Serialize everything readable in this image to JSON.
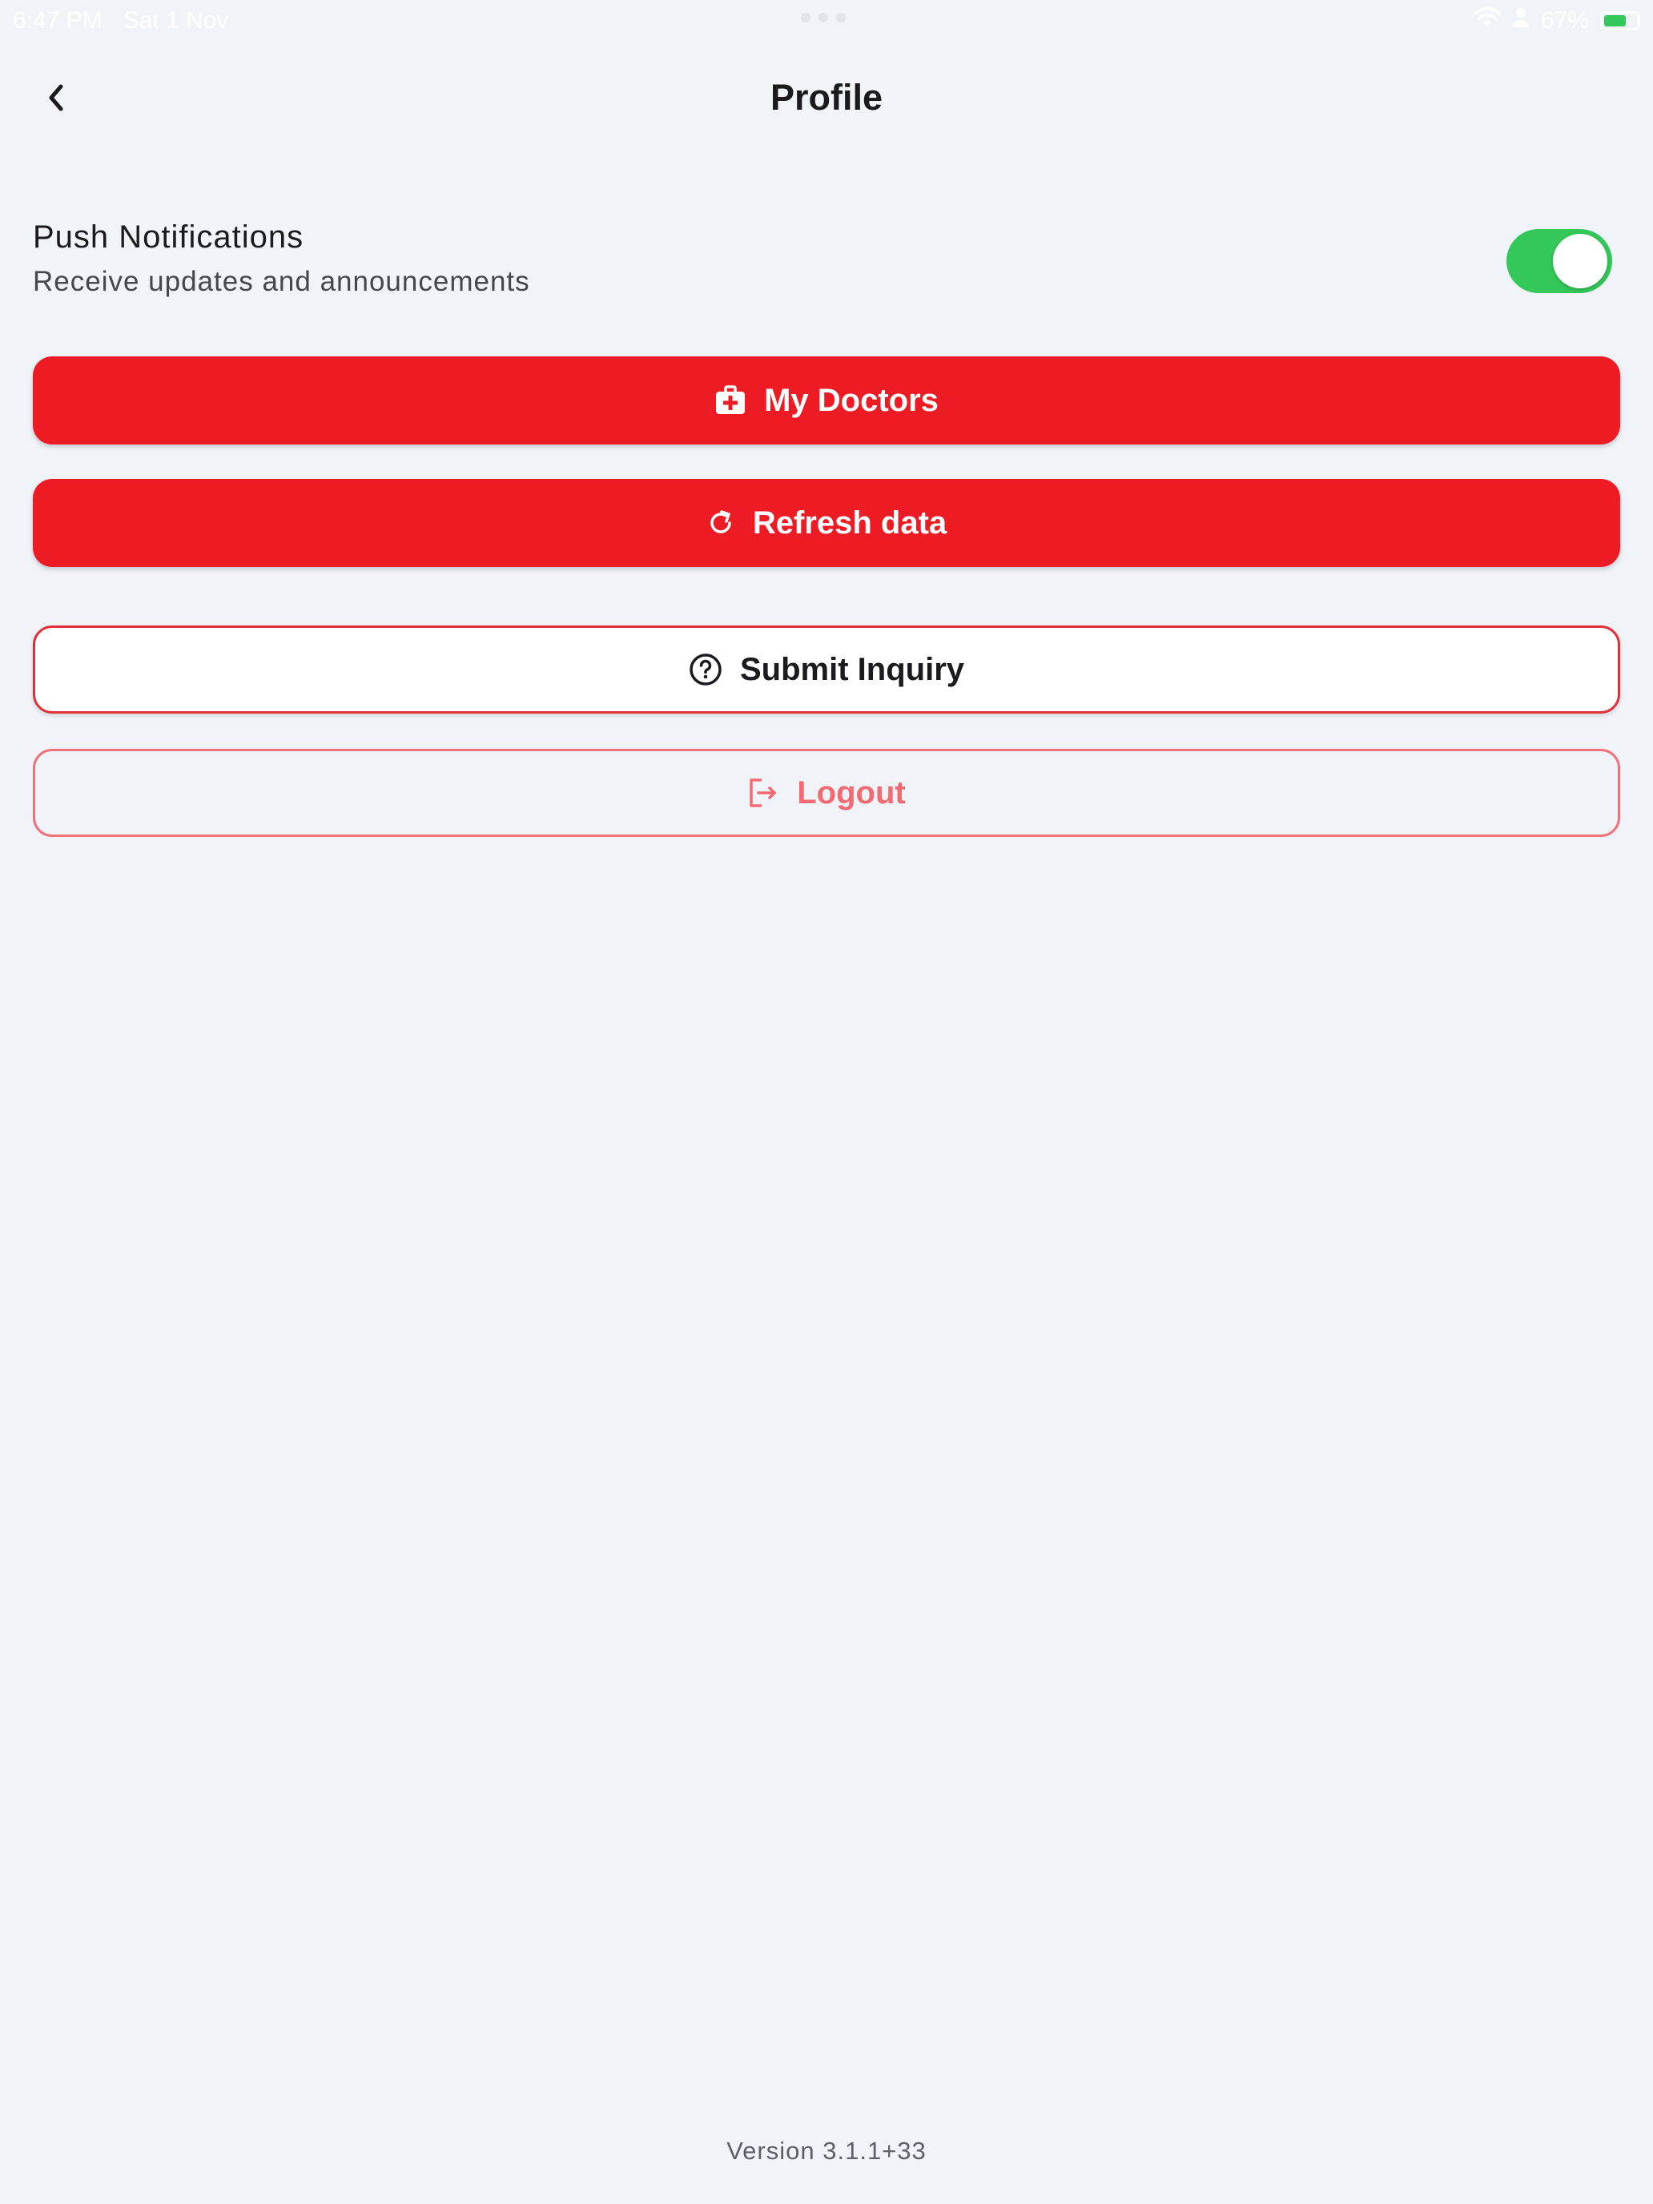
{
  "status_bar": {
    "time": "6:47 PM",
    "date": "Sat 1 Nov",
    "battery_percent": "67%",
    "battery_level": 0.67
  },
  "header": {
    "title": "Profile"
  },
  "push_notifications": {
    "title": "Push Notifications",
    "subtitle": "Receive updates and announcements",
    "enabled": true
  },
  "buttons": {
    "my_doctors": "My Doctors",
    "refresh_data": "Refresh data",
    "submit_inquiry": "Submit Inquiry",
    "logout": "Logout"
  },
  "footer": {
    "version": "Version 3.1.1+33"
  },
  "colors": {
    "primary_red": "#ed1c24",
    "toggle_green": "#34c759",
    "background": "#f0f4f9"
  }
}
